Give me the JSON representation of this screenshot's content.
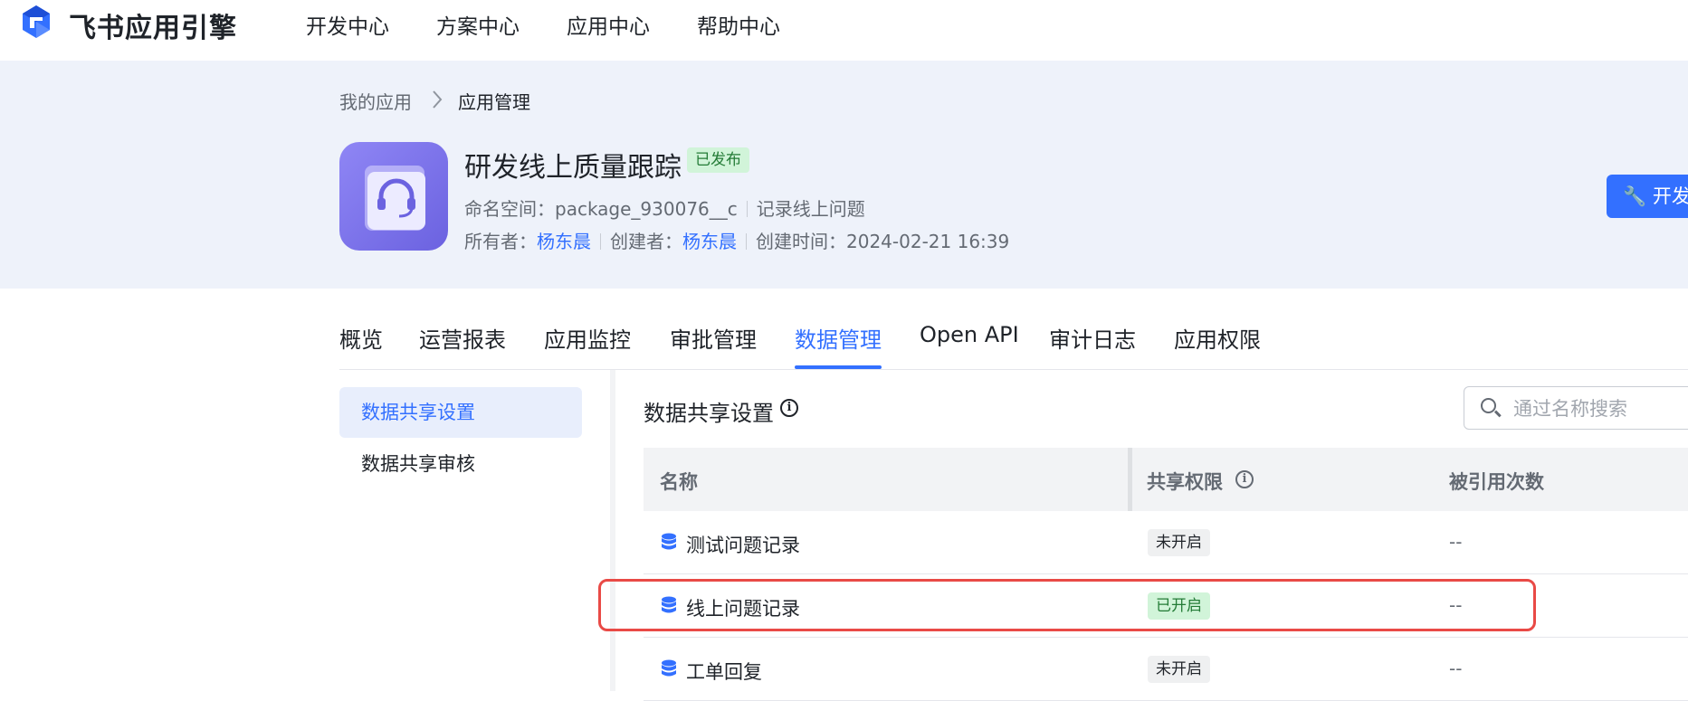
{
  "brand": {
    "name": "飞书应用引擎"
  },
  "nav": {
    "items": [
      "开发中心",
      "方案中心",
      "应用中心",
      "帮助中心"
    ]
  },
  "breadcrumb": {
    "parent": "我的应用",
    "current": "应用管理"
  },
  "app": {
    "title": "研发线上质量跟踪",
    "status": "已发布",
    "namespace_label": "命名空间：",
    "namespace": "package_930076__c",
    "description": "记录线上问题",
    "owner_label": "所有者：",
    "owner": "杨东晨",
    "creator_label": "创建者：",
    "creator": "杨东晨",
    "created_label": "创建时间：",
    "created_time": "2024-02-21 16:39"
  },
  "dev_button": {
    "label": "开发"
  },
  "tabs": [
    "概览",
    "运营报表",
    "应用监控",
    "审批管理",
    "数据管理",
    "Open API",
    "审计日志",
    "应用权限"
  ],
  "active_tab": "数据管理",
  "submenu": {
    "items": [
      "数据共享设置",
      "数据共享审核"
    ],
    "active": "数据共享设置"
  },
  "section": {
    "title": "数据共享设置"
  },
  "search": {
    "placeholder": "通过名称搜索"
  },
  "table": {
    "columns": [
      "名称",
      "共享权限",
      "被引用次数"
    ],
    "rows": [
      {
        "name": "测试问题记录",
        "permission": "未开启",
        "enabled": false,
        "count": "--"
      },
      {
        "name": "线上问题记录",
        "permission": "已开启",
        "enabled": true,
        "count": "--"
      },
      {
        "name": "工单回复",
        "permission": "未开启",
        "enabled": false,
        "count": "--"
      }
    ]
  },
  "colors": {
    "accent": "#3370ff",
    "success_bg": "#d1f4d9",
    "success_text": "#237b36",
    "highlight": "#e94a46"
  }
}
